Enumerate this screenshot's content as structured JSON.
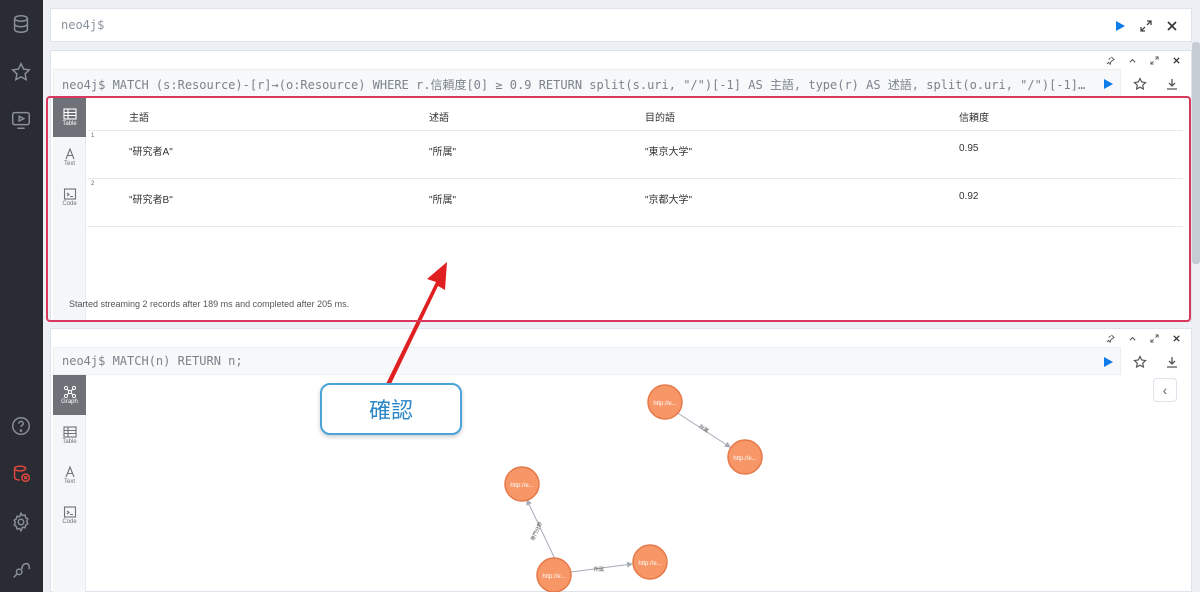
{
  "editor": {
    "prompt": "neo4j$"
  },
  "frame1": {
    "command": "neo4j$ MATCH (s:Resource)-[r]→(o:Resource) WHERE r.信頼度[0] ≥ 0.9 RETURN split(s.uri, \"/\")[-1] AS 主語, type(r) AS 述語, split(o.uri, \"/\")[-1]…",
    "tabs": [
      {
        "label": "Table",
        "active": true,
        "icon": "table-icon"
      },
      {
        "label": "Text",
        "active": false,
        "icon": "text-icon"
      },
      {
        "label": "Code",
        "active": false,
        "icon": "code-icon"
      }
    ],
    "columns": [
      "主語",
      "述語",
      "目的語",
      "信頼度"
    ],
    "rows": [
      {
        "num": "1",
        "cells": [
          "\"研究者A\"",
          "\"所属\"",
          "\"東京大学\"",
          "0.95"
        ]
      },
      {
        "num": "2",
        "cells": [
          "\"研究者B\"",
          "\"所属\"",
          "\"京都大学\"",
          "0.92"
        ]
      }
    ],
    "status": "Started streaming 2 records after 189 ms and completed after 205 ms."
  },
  "frame2": {
    "command": "neo4j$ MATCH(n) RETURN n;",
    "tabs": [
      {
        "label": "Graph",
        "active": true,
        "icon": "graph-icon"
      },
      {
        "label": "Table",
        "active": false,
        "icon": "table-icon"
      },
      {
        "label": "Text",
        "active": false,
        "icon": "text-icon"
      },
      {
        "label": "Code",
        "active": false,
        "icon": "code-icon"
      }
    ],
    "graph": {
      "node_label": "http://e...",
      "edge_labels": [
        "所属",
        "所属",
        "専門分野"
      ]
    }
  },
  "callout": {
    "text": "確認"
  },
  "colors": {
    "highlight": "#d8385c",
    "callout_border": "#4aa4d9",
    "node": "#f79767",
    "run": "#0d7ce8"
  }
}
